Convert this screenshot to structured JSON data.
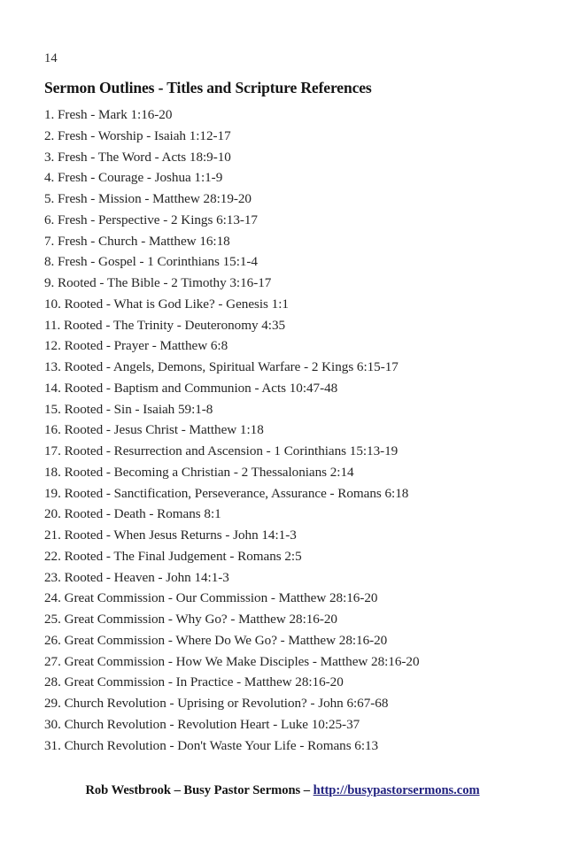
{
  "page": {
    "number": "14"
  },
  "heading": {
    "title": "Sermon Outlines - Titles and Scripture References"
  },
  "outlines": [
    "1. Fresh - Mark 1:16-20",
    "2. Fresh - Worship - Isaiah 1:12-17",
    "3. Fresh - The Word - Acts 18:9-10",
    "4. Fresh - Courage - Joshua 1:1-9",
    "5. Fresh - Mission - Matthew 28:19-20",
    "6. Fresh - Perspective - 2 Kings 6:13-17",
    "7. Fresh - Church - Matthew 16:18",
    "8. Fresh - Gospel - 1 Corinthians 15:1-4",
    "9. Rooted - The Bible - 2 Timothy 3:16-17",
    "10. Rooted - What is God Like? - Genesis 1:1",
    "11. Rooted - The Trinity - Deuteronomy 4:35",
    "12. Rooted - Prayer - Matthew 6:8",
    "13. Rooted - Angels, Demons, Spiritual Warfare - 2 Kings 6:15-17",
    "14. Rooted - Baptism and Communion - Acts 10:47-48",
    "15. Rooted - Sin - Isaiah 59:1-8",
    "16. Rooted - Jesus Christ - Matthew 1:18",
    "17. Rooted - Resurrection and Ascension - 1 Corinthians 15:13-19",
    "18. Rooted - Becoming a Christian - 2 Thessalonians 2:14",
    "19. Rooted - Sanctification, Perseverance, Assurance - Romans 6:18",
    "20. Rooted - Death - Romans 8:1",
    "21. Rooted - When Jesus Returns - John 14:1-3",
    "22. Rooted - The Final Judgement - Romans 2:5",
    "23. Rooted - Heaven - John 14:1-3",
    "24. Great Commission - Our Commission - Matthew 28:16-20",
    "25. Great Commission - Why Go? - Matthew 28:16-20",
    "26. Great Commission - Where Do We Go? - Matthew 28:16-20",
    "27. Great Commission - How We Make Disciples - Matthew 28:16-20",
    "28. Great Commission - In Practice - Matthew 28:16-20",
    "29. Church Revolution - Uprising or Revolution? - John 6:67-68",
    "30. Church Revolution - Revolution Heart - Luke 10:25-37",
    "31. Church Revolution - Don't Waste Your Life - Romans 6:13"
  ],
  "footer": {
    "byline": "Rob Westbrook – Busy Pastor Sermons – ",
    "link_text": "http://busypastorsermons.com",
    "link_color": "#21217f"
  }
}
